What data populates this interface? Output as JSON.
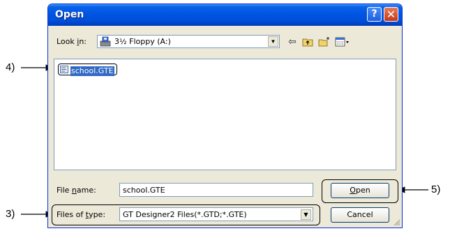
{
  "dialog": {
    "title": "Open",
    "help_glyph": "?",
    "close_glyph": "✕"
  },
  "look_in": {
    "label_prefix": "Look ",
    "label_key": "i",
    "label_suffix": "n:",
    "value": "3½ Floppy (A:)",
    "icon": "floppy-drive-icon"
  },
  "toolbar": {
    "back_icon": "back-arrow-icon",
    "up_icon": "up-folder-icon",
    "new_folder_icon": "new-folder-icon",
    "view_icon": "view-menu-icon"
  },
  "files": [
    {
      "name": "school.GTE",
      "icon": "document-icon",
      "selected": true
    }
  ],
  "file_name": {
    "label_prefix": "File ",
    "label_key": "n",
    "label_suffix": "ame:",
    "value": "school.GTE"
  },
  "file_type": {
    "label_prefix": "Files of ",
    "label_key": "t",
    "label_suffix": "ype:",
    "value": "GT Designer2 Files(*.GTD;*.GTE)"
  },
  "buttons": {
    "open_key": "O",
    "open_rest": "pen",
    "cancel": "Cancel"
  },
  "callouts": {
    "c3": "3)",
    "c4": "4)",
    "c5": "5)"
  },
  "colors": {
    "titlebar": "#0054e3",
    "dialog_bg": "#ece9d8",
    "selection": "#316ac5"
  }
}
